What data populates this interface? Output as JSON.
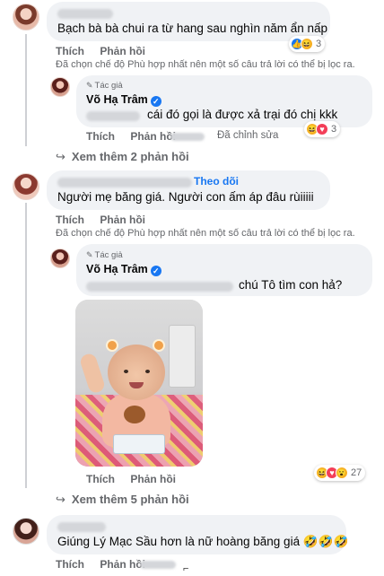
{
  "comments": [
    {
      "text": "Bạch bà bà chui ra từ hang sau nghìn năm ẩn nấp",
      "actions": [
        "Thích",
        "Phản hồi"
      ],
      "reaction_count": "3",
      "reactions": [
        "like-icon",
        "haha-icon"
      ],
      "filter_note": "Đã chọn chế độ Phù hợp nhất nên một số câu trả lời có thể bị lọc ra."
    },
    {
      "author_badge": "Tác giả",
      "author": "Võ Hạ Trâm",
      "text": "cái đó gọi là được xả trại đó chị kkk",
      "actions": [
        "Thích",
        "Phản hồi"
      ],
      "edited": "Đã chỉnh sửa",
      "reaction_count": "3",
      "reactions": [
        "haha-icon",
        "love-icon"
      ]
    },
    {
      "more_replies": "Xem thêm 2 phản hồi"
    },
    {
      "follow_label": "Theo dõi",
      "text": "Người mẹ băng giá. Người con ấm áp đâu rùiiiii",
      "actions": [
        "Thích",
        "Phản hồi"
      ],
      "filter_note": "Đã chọn chế độ Phù hợp nhất nên một số câu trả lời có thể bị lọc ra."
    },
    {
      "author_badge": "Tác giả",
      "author": "Võ Hạ Trâm",
      "text": "chú Tô tìm con hả?",
      "actions": [
        "Thích",
        "Phản hồi"
      ],
      "reaction_count": "27",
      "reactions": [
        "haha-icon",
        "love-icon",
        "wow-icon"
      ]
    },
    {
      "more_replies": "Xem thêm 5 phản hồi"
    },
    {
      "text": "Giúng Lý Mạc Sầu hơn là nữ hoàng băng giá 🤣🤣🤣",
      "actions": [
        "Thích",
        "Phản hồi"
      ]
    }
  ],
  "colors": {
    "bubble": "#f0f2f5",
    "secondary_text": "#65676b",
    "link_blue": "#1877f2"
  }
}
